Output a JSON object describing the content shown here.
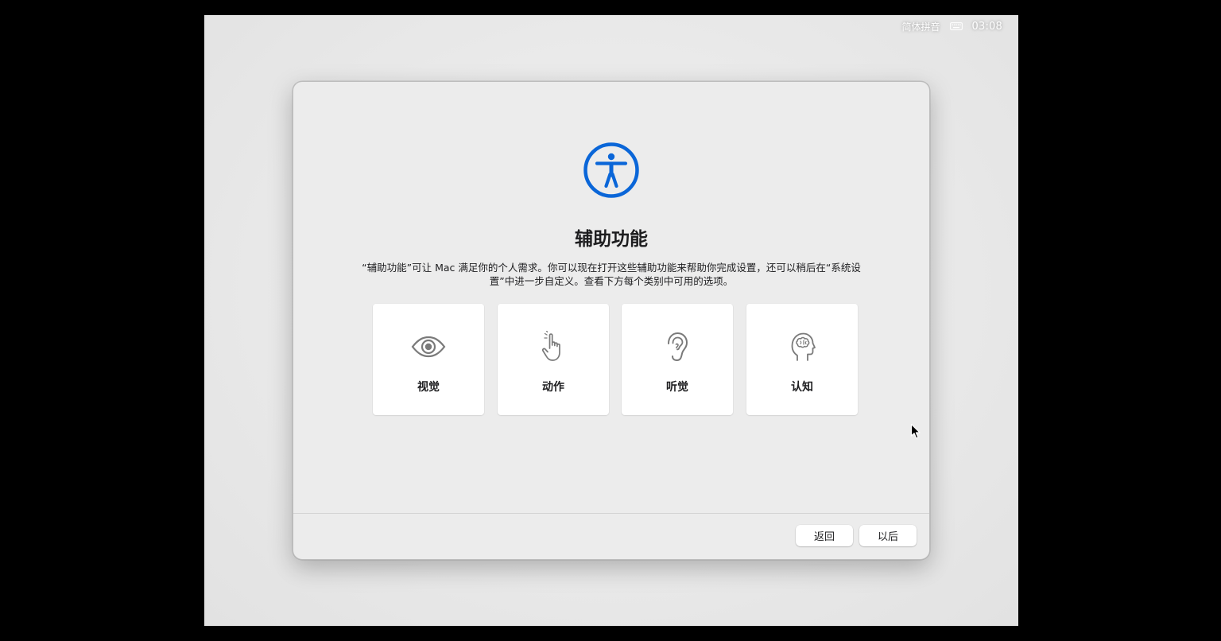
{
  "menubar": {
    "input_method": "简体拼音",
    "keyboard_icon": "keyboard-icon",
    "clock": "03:08"
  },
  "dialog": {
    "icon": "accessibility-icon",
    "accent_color": "#0a66d8",
    "title": "辅助功能",
    "description": "“辅助功能”可让 Mac 满足你的个人需求。你可以现在打开这些辅助功能来帮助你完成设置，还可以稍后在“系统设置”中进一步自定义。查看下方每个类别中可用的选项。",
    "categories": [
      {
        "label": "视觉",
        "icon": "eye-icon"
      },
      {
        "label": "动作",
        "icon": "hand-pointer-icon"
      },
      {
        "label": "听觉",
        "icon": "ear-icon"
      },
      {
        "label": "认知",
        "icon": "brain-head-icon"
      }
    ],
    "buttons": {
      "back": "返回",
      "later": "以后"
    }
  }
}
